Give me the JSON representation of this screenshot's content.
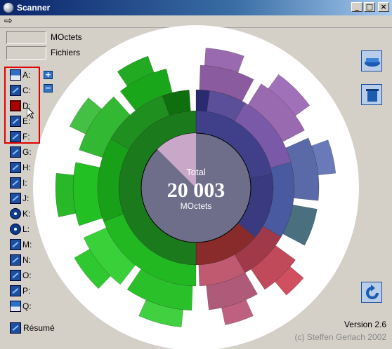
{
  "window": {
    "title": "Scanner",
    "min_label": "_",
    "max_label": "□",
    "close_label": "×"
  },
  "menubar": {
    "arrow_label": "⇨"
  },
  "stats": {
    "size_value": "",
    "size_unit": "MOctets",
    "files_value": "",
    "files_unit": "Fichiers"
  },
  "drives": [
    {
      "label": "A:",
      "icon": "floppy-icon"
    },
    {
      "label": "C:",
      "icon": "hard-drive-icon"
    },
    {
      "label": "D:",
      "icon": "hard-drive-icon"
    },
    {
      "label": "E:",
      "icon": "hard-drive-icon"
    },
    {
      "label": "F:",
      "icon": "hard-drive-icon"
    },
    {
      "label": "G:",
      "icon": "hard-drive-icon"
    },
    {
      "label": "H:",
      "icon": "hard-drive-icon"
    },
    {
      "label": "I:",
      "icon": "hard-drive-icon"
    },
    {
      "label": "J:",
      "icon": "hard-drive-icon"
    },
    {
      "label": "K:",
      "icon": "cd-icon"
    },
    {
      "label": "L:",
      "icon": "cd-icon"
    },
    {
      "label": "M:",
      "icon": "hard-drive-icon"
    },
    {
      "label": "N:",
      "icon": "hard-drive-icon"
    },
    {
      "label": "O:",
      "icon": "hard-drive-icon"
    },
    {
      "label": "P:",
      "icon": "hard-drive-icon"
    },
    {
      "label": "Q:",
      "icon": "floppy-icon"
    }
  ],
  "zoom": {
    "plus": "+",
    "minus": "−"
  },
  "resume": {
    "label": "Résumé"
  },
  "center": {
    "caption": "Total",
    "value": "20 003",
    "unit": "MOctets"
  },
  "footer": {
    "version": "Version 2.6",
    "copyright": "(c) Steffen Gerlach 2002"
  },
  "colors": {
    "background": "#d4d0c8",
    "chart_bg": "#ffffff",
    "selection_border": "#e00000",
    "center_fill": "#6e6d8a",
    "center_highlight": "#c9a7c9",
    "green_dark": "#1b7a1b",
    "green_bright": "#22c022",
    "blue_purple": "#3f3f8a",
    "purple": "#8b5ba0",
    "red": "#8a2b2b",
    "pink": "#c05a70"
  },
  "chart_data": {
    "type": "sunburst",
    "total": "20 003",
    "unit": "MOctets",
    "segments": [
      {
        "name": "",
        "share": 0.62,
        "color": "#1b7a1b"
      },
      {
        "name": "",
        "share": 0.22,
        "color": "#3f3f8a"
      },
      {
        "name": "",
        "share": 0.16,
        "color": "#8a2b2b"
      }
    ]
  }
}
